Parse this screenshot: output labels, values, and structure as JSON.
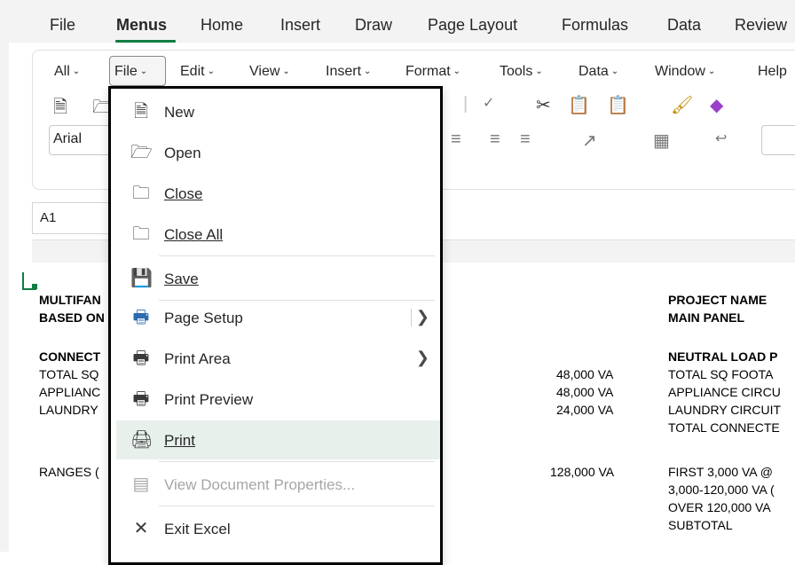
{
  "ribbon_tabs": [
    "File",
    "Menus",
    "Home",
    "Insert",
    "Draw",
    "Page Layout",
    "Formulas",
    "Data",
    "Review"
  ],
  "menus_bar": [
    "All",
    "File",
    "Edit",
    "View",
    "Insert",
    "Format",
    "Tools",
    "Data",
    "Window",
    "Help"
  ],
  "font": {
    "name": "Arial"
  },
  "namebox": {
    "value": "A1"
  },
  "file_menu": {
    "items": [
      {
        "label": "New",
        "icon": "new-document-icon"
      },
      {
        "label": "Open",
        "icon": "open-folder-icon"
      },
      {
        "label": "Close",
        "icon": "close-folder-icon"
      },
      {
        "label": "Close All",
        "icon": "close-all-icon"
      },
      {
        "label": "Save",
        "icon": "save-icon"
      },
      {
        "label": "Page Setup",
        "icon": "page-setup-icon",
        "submenu": true
      },
      {
        "label": "Print Area",
        "icon": "print-area-icon",
        "submenu": true
      },
      {
        "label": "Print Preview",
        "icon": "print-preview-icon"
      },
      {
        "label": "Print",
        "icon": "printer-icon",
        "highlighted": true
      },
      {
        "label": "View Document Properties...",
        "icon": "document-properties-icon",
        "disabled": true
      },
      {
        "label": "Exit Excel",
        "icon": "exit-icon"
      }
    ]
  },
  "sheet": {
    "left_col": [
      "MULTIFAN",
      "BASED ON",
      "CONNECT",
      "TOTAL SQ",
      "APPLIANC",
      "LAUNDRY",
      "RANGES ("
    ],
    "mid_col": [
      "48,000 VA",
      "48,000 VA",
      "24,000 VA",
      "128,000 VA"
    ],
    "right_col": [
      "PROJECT NAME",
      "MAIN PANEL",
      "NEUTRAL LOAD P",
      "TOTAL SQ FOOTA",
      "APPLIANCE CIRCU",
      "LAUNDRY CIRCUIT",
      "TOTAL CONNECTE",
      "FIRST 3,000 VA @",
      "3,000-120,000 VA (",
      "OVER 120,000 VA",
      "SUBTOTAL"
    ]
  },
  "colors": {
    "accent": "#107c41",
    "highlight": "#e8f0ec",
    "save_icon": "#8b2fa0"
  }
}
